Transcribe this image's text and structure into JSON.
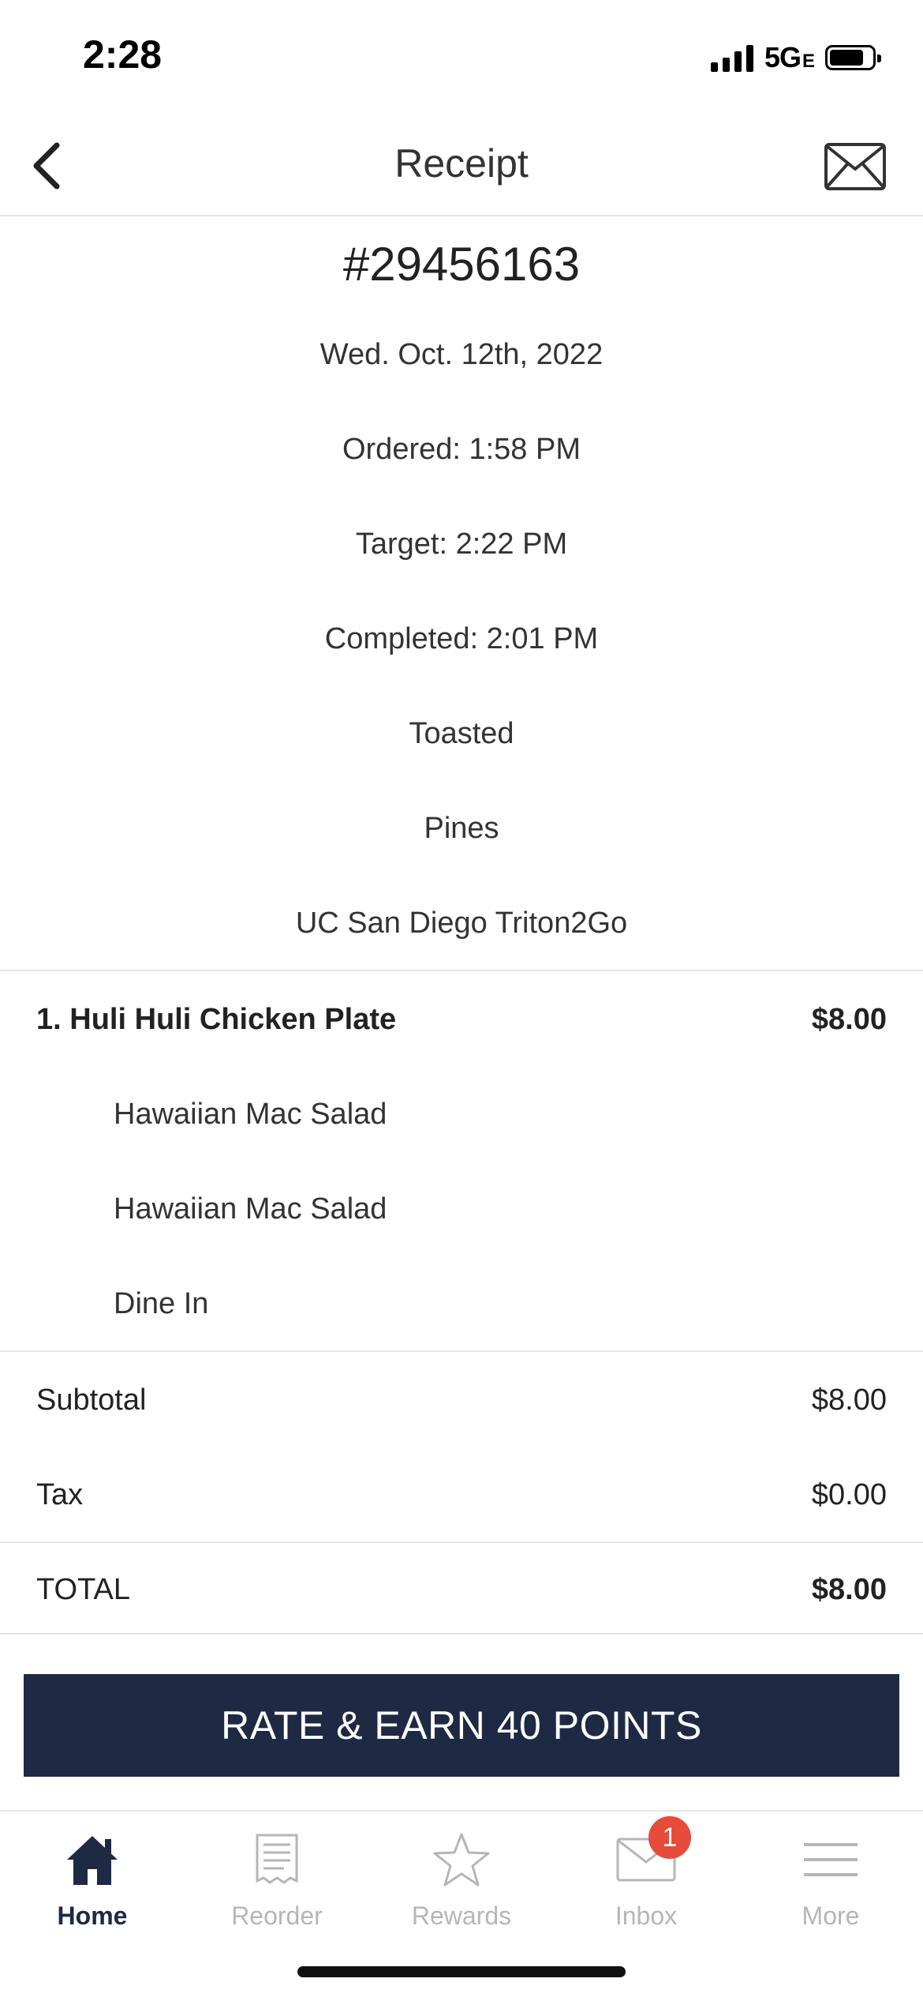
{
  "status_bar": {
    "time": "2:28",
    "network": "5G",
    "network_suffix": "E"
  },
  "header": {
    "title": "Receipt",
    "back_icon": "chevron-left-icon",
    "mail_icon": "envelope-icon"
  },
  "receipt": {
    "order_number": "#29456163",
    "date": "Wed. Oct. 12th, 2022",
    "ordered": "Ordered: 1:58 PM",
    "target": "Target: 2:22 PM",
    "completed": "Completed: 2:01 PM",
    "restaurant": "Toasted",
    "location": "Pines",
    "provider": "UC San Diego Triton2Go"
  },
  "items": [
    {
      "name": "1. Huli Huli Chicken Plate",
      "price": "$8.00",
      "modifiers": [
        "Hawaiian Mac Salad",
        "Hawaiian Mac Salad",
        "Dine In"
      ]
    }
  ],
  "totals": {
    "subtotal_label": "Subtotal",
    "subtotal_value": "$8.00",
    "tax_label": "Tax",
    "tax_value": "$0.00",
    "total_label": "TOTAL",
    "total_value": "$8.00"
  },
  "cta": {
    "label": "RATE & EARN 40 POINTS"
  },
  "colors": {
    "brand": "#1e2a44",
    "badge": "#e64b3c",
    "inactive": "#b6b6b6"
  },
  "tabbar": {
    "tabs": [
      {
        "label": "Home",
        "icon": "home-icon",
        "active": true
      },
      {
        "label": "Reorder",
        "icon": "receipt-icon"
      },
      {
        "label": "Rewards",
        "icon": "star-icon"
      },
      {
        "label": "Inbox",
        "icon": "envelope-icon",
        "badge": "1"
      },
      {
        "label": "More",
        "icon": "menu-icon"
      }
    ]
  }
}
